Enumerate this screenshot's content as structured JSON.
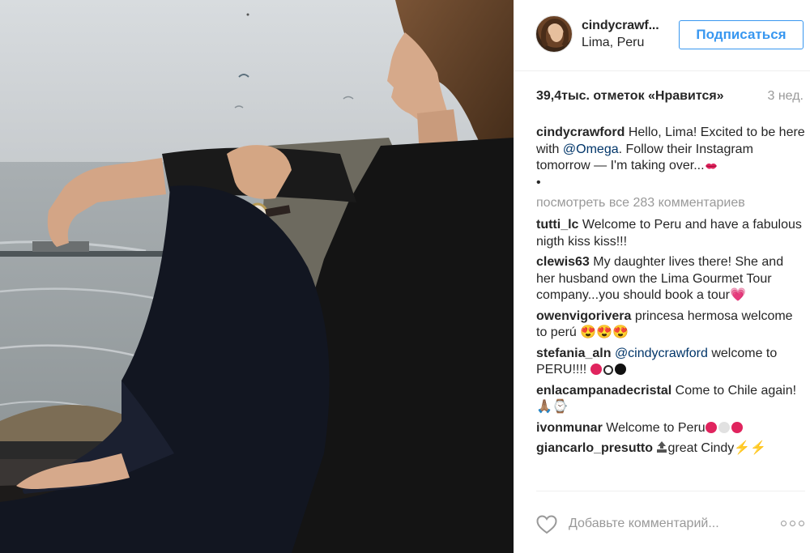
{
  "post": {
    "username": "cindycrawf...",
    "location": "Lima, Peru",
    "follow_label": "Подписаться",
    "likes": "39,4тыс. отметок «Нравится»",
    "time": "3 нед.",
    "caption": {
      "author": "cindycrawford",
      "text_before": "Hello, Lima! Excited to be here with ",
      "mention": "@Omega",
      "text_after": ". Follow their Instagram tomorrow — I'm taking over...",
      "bullet": "•"
    },
    "view_all": "посмотреть все 283 комментариев"
  },
  "comments": [
    {
      "author": "tutti_lc",
      "text": "Welcome to Peru and have a fabulous nigth kiss kiss!!!",
      "emoji": ""
    },
    {
      "author": "clewis63",
      "text": "My daughter lives there! She and her husband own the Lima Gourmet Tour company...you should book a tour",
      "emoji": "💗"
    },
    {
      "author": "owenvigorivera",
      "text": "princesa hermosa welcome to perú ",
      "emoji": "😍😍😍"
    },
    {
      "author": "stefania_aln",
      "mention": "@cindycrawford",
      "text": " welcome to PERU!!!! ",
      "emoji": ""
    },
    {
      "author": "enlacampanadecristal",
      "text": "Come to Chile again! ",
      "emoji": "🙏🏽⌚"
    },
    {
      "author": "ivonmunar",
      "text": "Welcome to Peru",
      "emoji": ""
    },
    {
      "author": "giancarlo_presutto",
      "text": "great Cindy",
      "emoji": "⚡⚡"
    }
  ],
  "icons": {
    "avatar": "avatar-photo",
    "like": "heart-outline-icon",
    "more": "more-options-icon",
    "kiss": "kiss-lips-icon",
    "top": "top-arrow-icon"
  },
  "comment_input": {
    "placeholder": "Добавьте комментарий..."
  },
  "colors": {
    "link": "#003569",
    "follow_blue": "#3897f0",
    "muted": "#999999",
    "text": "#262626"
  }
}
